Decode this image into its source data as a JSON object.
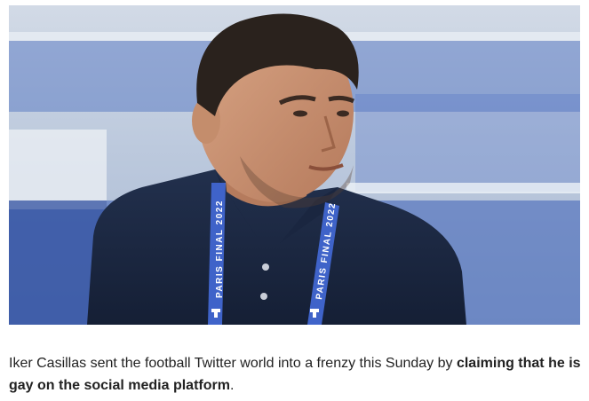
{
  "photo": {
    "subject": "photo",
    "lanyard_text": "PARIS FINAL 2022",
    "colors": {
      "shirt": "#1d2a44",
      "lanyard": "#3f63c9",
      "stands": "#3b5fb7",
      "sky": "#c9d3e3"
    }
  },
  "caption": {
    "part1": "Iker Casillas sent the football Twitter world into a frenzy this Sunday by ",
    "bold": "claiming that he is gay on the social media platform",
    "part2": "."
  }
}
